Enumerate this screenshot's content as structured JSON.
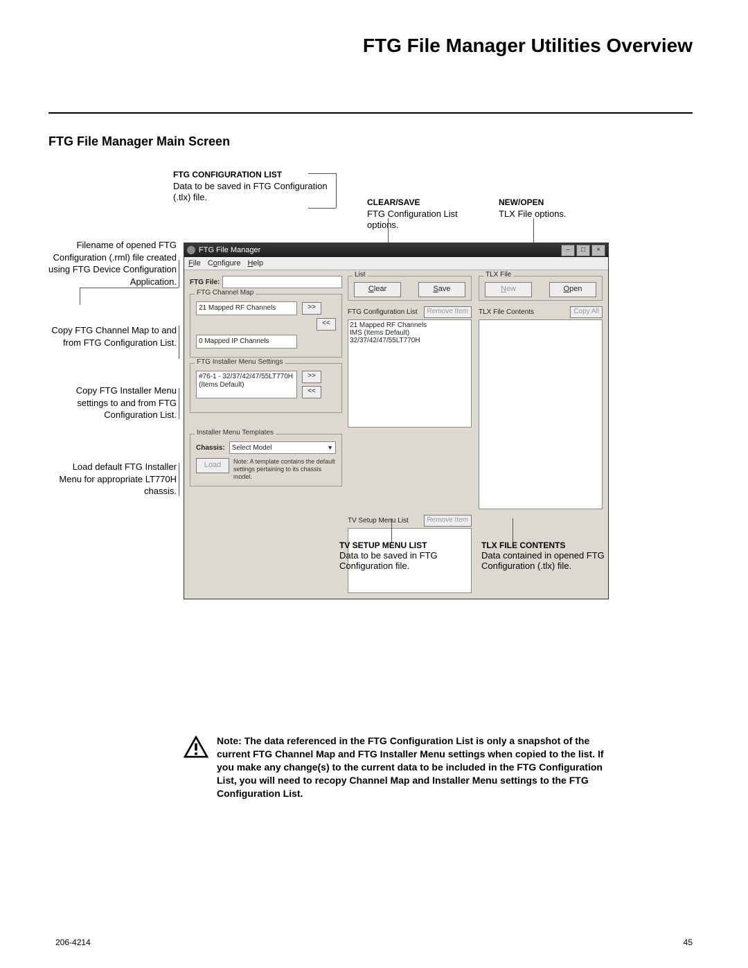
{
  "page": {
    "title": "FTG File Manager Utilities Overview",
    "section": "FTG File Manager Main Screen",
    "doc_number": "206-4214",
    "page_number": "45"
  },
  "top_annotations": {
    "config_list": {
      "title": "FTG CONFIGURATION LIST",
      "body": "Data to be saved in FTG Configuration (.tlx) file."
    },
    "clear_save": {
      "title": "CLEAR/SAVE",
      "body": "FTG Configuration List options."
    },
    "new_open": {
      "title": "NEW/OPEN",
      "body": "TLX File options."
    }
  },
  "left_annotations": {
    "filename": "Filename of opened FTG Configuration (.rml) file created using FTG Device Configuration Application.",
    "copy_map": "Copy FTG Channel Map to and from FTG Configuration List.",
    "copy_installer": "Copy FTG Installer Menu settings to and from FTG Configuration List.",
    "load_template": "Load default FTG Installer Menu for appropriate LT770H chassis."
  },
  "bottom_annotations": {
    "tv_setup": {
      "title": "TV SETUP MENU LIST",
      "body": "Data to be saved in FTG Configuration file."
    },
    "tlx_contents": {
      "title": "TLX FILE CONTENTS",
      "body": "Data contained in opened FTG Configuration (.tlx) file."
    }
  },
  "note": "Note: The data referenced in the FTG Configuration List is only a snapshot of the current FTG Channel Map and FTG Installer Menu settings when copied to the list. If you make any change(s) to the current data to be included in the FTG Configuration List, you will need to recopy Channel Map and Installer Menu settings to the FTG Configuration List.",
  "win": {
    "title": "FTG File Manager",
    "menu": {
      "file": "File",
      "configure": "Configure",
      "help": "Help"
    },
    "ftg_file_label": "FTG File:",
    "channel_map": {
      "legend": "FTG Channel Map",
      "rf": "21 Mapped RF Channels",
      "ip": "0 Mapped IP Channels"
    },
    "installer_menu": {
      "legend": "FTG Installer Menu Settings",
      "text": "#76-1 - 32/37/42/47/55LT770H (Items Default)"
    },
    "templates": {
      "legend": "Installer Menu Templates",
      "chassis_label": "Chassis:",
      "chassis_value": "Select Model",
      "load": "Load",
      "note": "Note: A template contains the default settings pertaining to its chassis model."
    },
    "list_group": {
      "legend": "List",
      "clear": "Clear",
      "save": "Save"
    },
    "tlx_group": {
      "legend": "TLX File",
      "new": "New",
      "open": "Open"
    },
    "ftg_config_list": {
      "label": "FTG Configuration List",
      "remove": "Remove Item",
      "line1": "21 Mapped RF Channels",
      "line2": "IMS (Items Default) 32/37/42/47/55LT770H"
    },
    "tlx_contents": {
      "label": "TLX File Contents",
      "copy_all": "Copy All"
    },
    "tv_setup": {
      "label": "TV Setup Menu List",
      "remove": "Remove Item"
    },
    "arrows": {
      "right": ">>",
      "left": "<<"
    }
  }
}
